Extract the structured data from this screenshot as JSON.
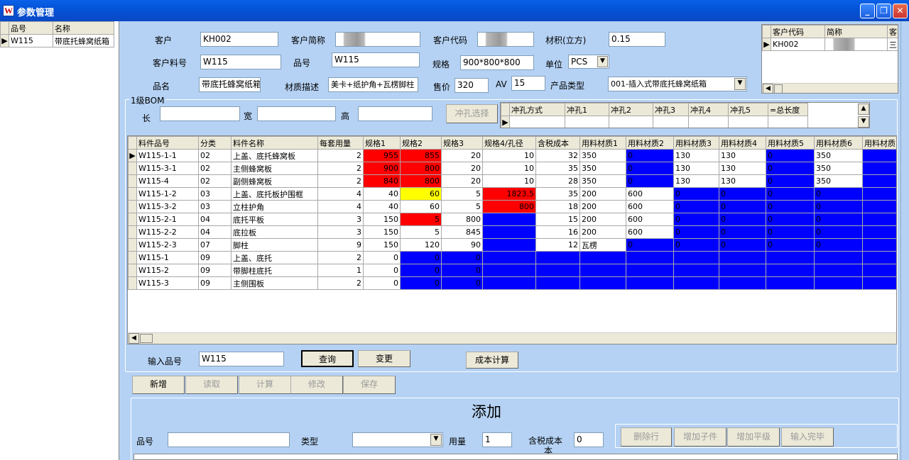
{
  "window": {
    "title": "参数管理",
    "min": "_",
    "restore": "❐",
    "close": "✕"
  },
  "left_list": {
    "headers": [
      "品号",
      "名称"
    ],
    "rows": [
      [
        "W115",
        "带底托蜂窝纸箱"
      ]
    ]
  },
  "form": {
    "customer_label": "客户",
    "customer": "KH002",
    "customer_short_label": "客户简称",
    "customer_short": "",
    "customer_code_label": "客户代码",
    "customer_code": "",
    "volume_label": "材积(立方)",
    "volume": "0.15",
    "customer_part_label": "客户料号",
    "customer_part": "W115",
    "part_no_label": "品号",
    "part_no": "W115",
    "spec_label": "规格",
    "spec": "900*800*800",
    "unit_label": "单位",
    "unit": "PCS",
    "name_label": "品名",
    "name": "带底托蜂窝纸箱",
    "material_desc_label": "材质描述",
    "material_desc": "美卡+纸护角+瓦楞脚柱",
    "price_label": "售价",
    "price": "320",
    "av_label": "AV",
    "av": "15",
    "product_type_label": "产品类型",
    "product_type": "001-插入式带底托蜂窝纸箱"
  },
  "cust_grid": {
    "headers": [
      "客户代码",
      "简称",
      "客"
    ],
    "rows": [
      [
        "KH002",
        "",
        "三"
      ]
    ]
  },
  "bom": {
    "title": "1级BOM",
    "len_label": "长",
    "width_label": "宽",
    "height_label": "高",
    "punch_button": "冲孔选择",
    "punch_headers": [
      "冲孔方式",
      "冲孔1",
      "冲孔2",
      "冲孔3",
      "冲孔4",
      "冲孔5",
      "=总长度"
    ]
  },
  "main_grid": {
    "headers": [
      "料件品号",
      "分类",
      "料件名称",
      "每套用量",
      "规格1",
      "规格2",
      "规格3",
      "规格4/孔径",
      "含税成本",
      "用料材质1",
      "用料材质2",
      "用料材质3",
      "用料材质4",
      "用料材质5",
      "用料材质6",
      "用料材质"
    ],
    "rows": [
      {
        "cells": [
          "W115-1-1",
          "02",
          "上盖、底托蜂窝板",
          "2",
          "955",
          "855",
          "20",
          "10",
          "32",
          "350",
          "0",
          "130",
          "130",
          "0",
          "350",
          ""
        ],
        "colors": [
          "",
          "",
          "",
          "",
          "r",
          "r",
          "",
          "",
          "",
          "",
          "b",
          "",
          "",
          "b",
          "",
          "b"
        ]
      },
      {
        "cells": [
          "W115-3-1",
          "02",
          "主侧蜂窝板",
          "2",
          "900",
          "800",
          "20",
          "10",
          "35",
          "350",
          "0",
          "130",
          "130",
          "0",
          "350",
          ""
        ],
        "colors": [
          "",
          "",
          "",
          "",
          "r",
          "r",
          "",
          "",
          "",
          "",
          "b",
          "",
          "",
          "b",
          "",
          "b"
        ]
      },
      {
        "cells": [
          "W115-4",
          "02",
          "副侧蜂窝板",
          "2",
          "840",
          "800",
          "20",
          "10",
          "28",
          "350",
          "0",
          "130",
          "130",
          "0",
          "350",
          ""
        ],
        "colors": [
          "",
          "",
          "",
          "",
          "r",
          "r",
          "",
          "",
          "",
          "",
          "b",
          "",
          "",
          "b",
          "",
          "b"
        ]
      },
      {
        "cells": [
          "W115-1-2",
          "03",
          "上盖、底托板护围框",
          "4",
          "40",
          "60",
          "5",
          "1823.5",
          "35",
          "200",
          "600",
          "0",
          "0",
          "0",
          "0",
          ""
        ],
        "colors": [
          "",
          "",
          "",
          "",
          "",
          "y",
          "",
          "r",
          "",
          "",
          "",
          "b",
          "b",
          "b",
          "b",
          "b"
        ]
      },
      {
        "cells": [
          "W115-3-2",
          "03",
          "立柱护角",
          "4",
          "40",
          "60",
          "5",
          "800",
          "18",
          "200",
          "600",
          "0",
          "0",
          "0",
          "0",
          ""
        ],
        "colors": [
          "",
          "",
          "",
          "",
          "",
          "",
          "",
          "r",
          "",
          "",
          "",
          "b",
          "b",
          "b",
          "b",
          "b"
        ]
      },
      {
        "cells": [
          "W115-2-1",
          "04",
          "底托平板",
          "3",
          "150",
          "5",
          "800",
          "",
          "15",
          "200",
          "600",
          "0",
          "0",
          "0",
          "0",
          ""
        ],
        "colors": [
          "",
          "",
          "",
          "",
          "",
          "r",
          "",
          "b",
          "",
          "",
          "",
          "b",
          "b",
          "b",
          "b",
          "b"
        ]
      },
      {
        "cells": [
          "W115-2-2",
          "04",
          "底拉板",
          "3",
          "150",
          "5",
          "845",
          "",
          "16",
          "200",
          "600",
          "0",
          "0",
          "0",
          "0",
          ""
        ],
        "colors": [
          "",
          "",
          "",
          "",
          "",
          "",
          "",
          "b",
          "",
          "",
          "",
          "b",
          "b",
          "b",
          "b",
          "b"
        ]
      },
      {
        "cells": [
          "W115-2-3",
          "07",
          "脚柱",
          "9",
          "150",
          "120",
          "90",
          "",
          "12",
          "瓦楞",
          "0",
          "0",
          "0",
          "0",
          "0",
          ""
        ],
        "colors": [
          "",
          "",
          "",
          "",
          "",
          "",
          "",
          "b",
          "",
          "",
          "b",
          "b",
          "b",
          "b",
          "b",
          "b"
        ]
      },
      {
        "cells": [
          "W115-1",
          "09",
          "上盖、底托",
          "2",
          "0",
          "0",
          "0",
          "",
          "",
          "",
          "",
          "",
          "",
          "",
          "",
          ""
        ],
        "colors": [
          "",
          "",
          "",
          "",
          "",
          "b",
          "b",
          "b",
          "b",
          "b",
          "b",
          "b",
          "b",
          "b",
          "b",
          "b"
        ]
      },
      {
        "cells": [
          "W115-2",
          "09",
          "带脚柱底托",
          "1",
          "0",
          "0",
          "0",
          "",
          "",
          "",
          "",
          "",
          "",
          "",
          "",
          ""
        ],
        "colors": [
          "",
          "",
          "",
          "",
          "",
          "b",
          "b",
          "b",
          "b",
          "b",
          "b",
          "b",
          "b",
          "b",
          "b",
          "b"
        ]
      },
      {
        "cells": [
          "W115-3",
          "09",
          "主侧围板",
          "2",
          "0",
          "0",
          "0",
          "",
          "",
          "",
          "",
          "",
          "",
          "",
          "",
          ""
        ],
        "colors": [
          "",
          "",
          "",
          "",
          "",
          "b",
          "b",
          "b",
          "b",
          "b",
          "b",
          "b",
          "b",
          "b",
          "b",
          "b"
        ]
      }
    ]
  },
  "query": {
    "label": "输入品号",
    "value": "W115",
    "query_button": "查询",
    "change_button": "变更",
    "cost_button": "成本计算"
  },
  "toolbar": {
    "new": "新增",
    "read": "读取",
    "calc": "计算",
    "edit": "修改",
    "save": "保存"
  },
  "add_panel": {
    "title": "添加",
    "part_label": "品号",
    "part": "",
    "type_label": "类型",
    "type": "",
    "qty_label": "用量",
    "qty": "1",
    "cost_label": "含税成本",
    "cost_label2": "本",
    "cost": "0",
    "delete_row": "删除行",
    "add_child": "增加子件",
    "add_level": "增加平级",
    "input_done": "输入完毕"
  }
}
